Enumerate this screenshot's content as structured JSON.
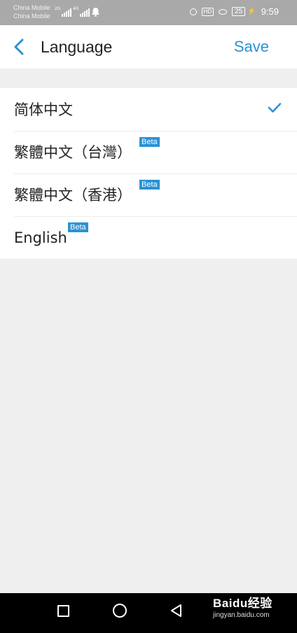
{
  "status_bar": {
    "carrier_1": "China Mobile",
    "carrier_2": "China Mobile",
    "signal_1_tag": "2G",
    "signal_2_tag": "4G",
    "hd_label": "HD",
    "battery_level": "25",
    "time": "9:59",
    "icons": [
      "alarm-icon",
      "hd-icon",
      "eye-icon",
      "battery-icon",
      "charging-icon"
    ]
  },
  "header": {
    "back_icon": "chevron-left-icon",
    "title": "Language",
    "save_label": "Save"
  },
  "languages": [
    {
      "label": "简体中文",
      "beta": "",
      "selected": true
    },
    {
      "label": "繁體中文（台灣）",
      "beta": "Beta",
      "selected": false
    },
    {
      "label": "繁體中文（香港）",
      "beta": "Beta",
      "selected": false
    },
    {
      "label": "English",
      "beta": "Beta",
      "selected": false
    }
  ],
  "nav_bar": {
    "icons": [
      "recent-apps-icon",
      "home-icon",
      "back-icon"
    ]
  },
  "watermark": {
    "main": "Baidu经验",
    "sub": "jingyan.baidu.com"
  },
  "colors": {
    "accent": "#2a92d5",
    "status_bar_bg": "#a9a9a9",
    "page_bg": "#efefef",
    "nav_bar_bg": "#000000"
  }
}
